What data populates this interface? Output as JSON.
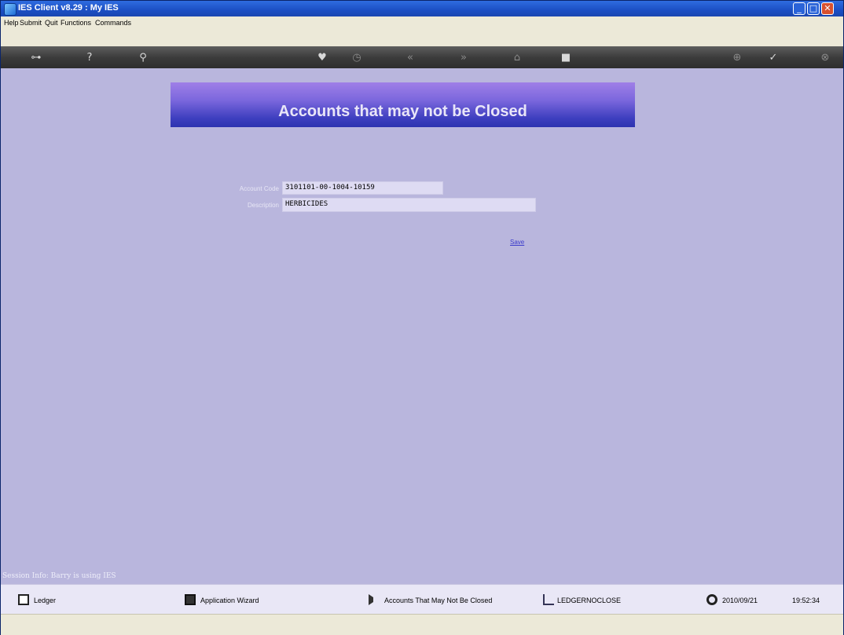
{
  "window": {
    "title": "IES Client v8.29 : My IES"
  },
  "menu": [
    "Help",
    "Submit",
    "Quit",
    "Functions",
    "Commands"
  ],
  "toolbar": {
    "icons": [
      "key-icon",
      "help-icon",
      "search-icon",
      "heart-icon",
      "clock-icon",
      "rewind-icon",
      "forward-icon",
      "home-icon",
      "stop-icon",
      "add-icon",
      "check-icon",
      "close-icon"
    ]
  },
  "form": {
    "title": "Accounts that may not be Closed",
    "account_code_label": "Account Code",
    "account_code_value": "3101101-00-1004-10159",
    "description_label": "Description",
    "description_value": "HERBICIDES",
    "save_label": "Save"
  },
  "session": {
    "info": "Session Info: Barry is using IES"
  },
  "status": {
    "ledger": "Ledger",
    "app_wizard": "Application Wizard",
    "screen_name": "Accounts That May Not Be Closed",
    "screen_code": "LEDGERNOCLOSE",
    "date": "2010/09/21",
    "time": "19:52:34"
  },
  "colors": {
    "accent": "#3e3fbf",
    "background": "#b9b6dd"
  }
}
